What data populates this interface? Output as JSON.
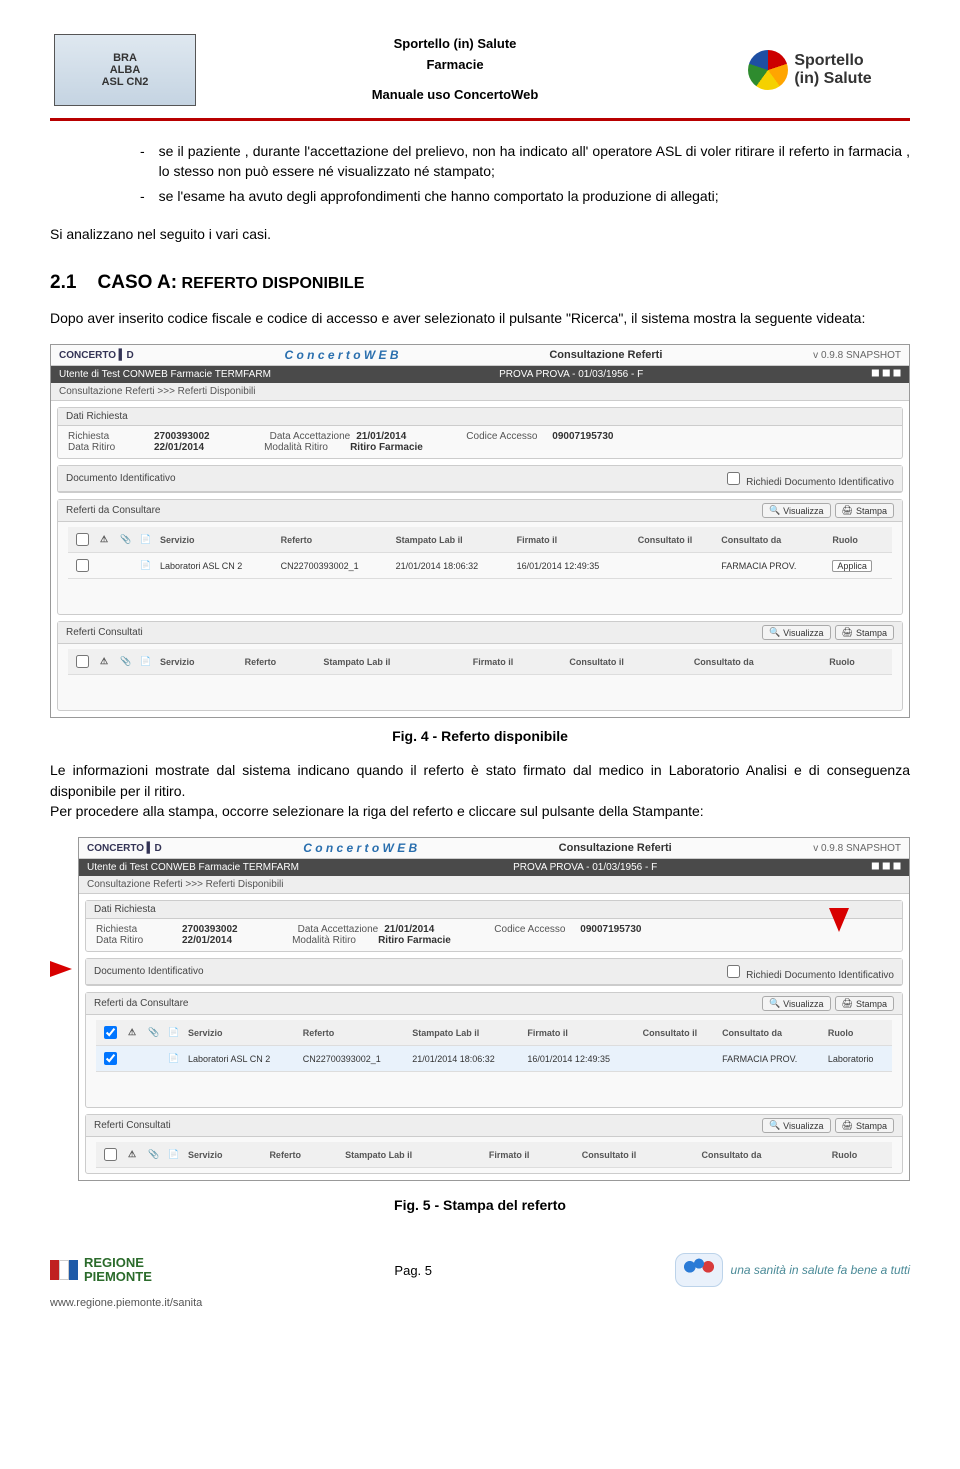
{
  "header": {
    "asl_top": "BRA",
    "asl_mid": "ALBA",
    "asl_bottom": "ASL CN2",
    "center_line1": "Sportello (in) Salute",
    "center_line2": "Farmacie",
    "center_line3": "Manuale uso ConcertoWeb",
    "right_line1": "Sportello",
    "right_line2": "(in) Salute"
  },
  "intro": {
    "bullet1": "se il paziente , durante l'accettazione del prelievo, non ha indicato all' operatore ASL di voler ritirare il referto in farmacia , lo stesso non può essere né visualizzato né stampato;",
    "bullet2": "se l'esame ha avuto degli approfondimenti che hanno comportato la produzione di allegati;",
    "line3": "Si analizzano nel seguito i vari casi."
  },
  "section": {
    "num": "2.1",
    "title_strong": "CASO A:",
    "title_rest": " REFERTO DISPONIBILE",
    "intro": "Dopo aver inserito codice fiscale e codice di accesso e aver selezionato il pulsante \"Ricerca\", il sistema mostra la seguente videata:"
  },
  "shot": {
    "brand": "C o n c e r t o W E B",
    "title": "Consultazione Referti",
    "version": "v 0.9.8 SNAPSHOT",
    "userbar_left": "Utente di Test CONWEB Farmacie    TERMFARM",
    "userbar_center": "PROVA PROVA - 01/03/1956 - F",
    "crumb": "Consultazione Referti  >>>  Referti Disponibili",
    "panel_dati": {
      "head": "Dati Richiesta",
      "richiesta_l": "Richiesta",
      "richiesta_v": "2700393002",
      "dataacc_l": "Data Accettazione",
      "dataacc_v": "21/01/2014",
      "codacc_l": "Codice Accesso",
      "codacc_v": "09007195730",
      "dataret_l": "Data Ritiro",
      "dataret_v": "22/01/2014",
      "modret_l": "Modalità Ritiro",
      "modret_v": "Ritiro Farmacie"
    },
    "panel_doc": {
      "head": "Documento Identificativo",
      "chk": "Richiedi Documento Identificativo"
    },
    "panel_cons": {
      "head": "Referti da Consultare",
      "btn_view": "Visualizza",
      "btn_print": "Stampa",
      "h1": "Servizio",
      "h2": "Referto",
      "h3": "Stampato Lab il",
      "h4": "Firmato il",
      "h5": "Consultato il",
      "h6": "Consultato da",
      "h7": "Ruolo",
      "row_serv": "Laboratori ASL CN 2",
      "row_ref": "CN22700393002_1",
      "row_stamp": "21/01/2014 18:06:32",
      "row_firm": "16/01/2014 12:49:35",
      "row_consda": "FARMACIA PROV.",
      "applica": "Applica",
      "ruolo": "Laboratorio"
    },
    "panel_consultati": {
      "head": "Referti Consultati"
    }
  },
  "fig4": "Fig.  4 - Referto disponibile",
  "para2a": "Le informazioni mostrate dal sistema indicano quando il referto è stato firmato dal medico in Laboratorio Analisi e di conseguenza disponibile per il ritiro.",
  "para2b": "Per procedere alla stampa, occorre selezionare la riga del referto e cliccare sul pulsante della Stampante:",
  "fig5": "Fig.  5 - Stampa del referto",
  "footer": {
    "piemonte": "REGIONE\nPIEMONTE",
    "pag": "Pag. 5",
    "tag": "una sanità in salute fa bene a tutti",
    "url": "www.regione.piemonte.it/sanita"
  }
}
